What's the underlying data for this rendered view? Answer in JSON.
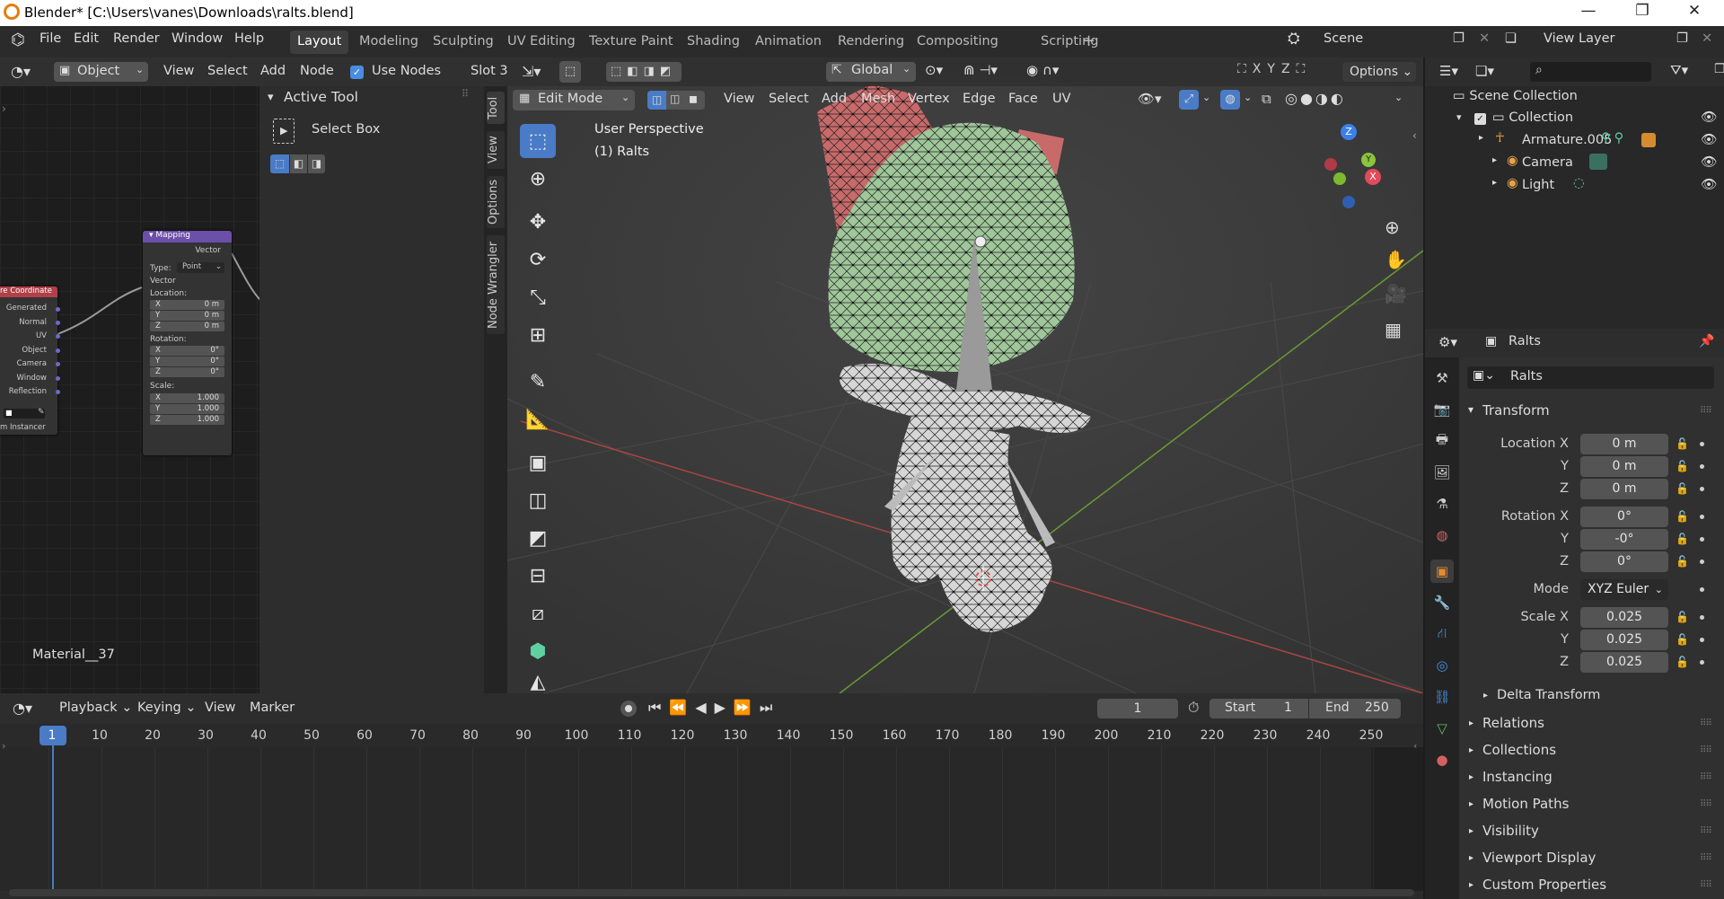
{
  "window": {
    "title": "Blender* [C:\\Users\\vanes\\Downloads\\ralts.blend]",
    "controls": [
      "—",
      "❐",
      "✕"
    ]
  },
  "menu": [
    "File",
    "Edit",
    "Render",
    "Window",
    "Help"
  ],
  "workspaces": [
    "Layout",
    "Modeling",
    "Sculpting",
    "UV Editing",
    "Texture Paint",
    "Shading",
    "Animation",
    "Rendering",
    "Compositing",
    "Scripting",
    "+"
  ],
  "active_workspace": "Layout",
  "scene": {
    "name": "Scene",
    "view_layer": "View Layer"
  },
  "node_editor": {
    "header": {
      "object_mode": "Object",
      "menus": [
        "View",
        "Select",
        "Add",
        "Node"
      ],
      "use_nodes_label": "Use Nodes",
      "use_nodes_checked": true,
      "slot": "Slot 3"
    },
    "material_name": "Material__37",
    "mapping_node": {
      "title": "Mapping",
      "output": "Vector",
      "type_label": "Type:",
      "type_value": "Point",
      "input": "Vector",
      "location_label": "Location:",
      "location": [
        {
          "axis": "X",
          "value": "0 m"
        },
        {
          "axis": "Y",
          "value": "0 m"
        },
        {
          "axis": "Z",
          "value": "0 m"
        }
      ],
      "rotation_label": "Rotation:",
      "rotation": [
        {
          "axis": "X",
          "value": "0°"
        },
        {
          "axis": "Y",
          "value": "0°"
        },
        {
          "axis": "Z",
          "value": "0°"
        }
      ],
      "scale_label": "Scale:",
      "scale": [
        {
          "axis": "X",
          "value": "1.000"
        },
        {
          "axis": "Y",
          "value": "1.000"
        },
        {
          "axis": "Z",
          "value": "1.000"
        }
      ]
    },
    "texcoord_node": {
      "title": "re Coordinate",
      "outputs": [
        "Generated",
        "Normal",
        "UV",
        "Object",
        "Camera",
        "Window",
        "Reflection"
      ],
      "footer": "m Instancer"
    }
  },
  "tool_panel": {
    "title": "Active Tool",
    "tool_name": "Select Box"
  },
  "sidebar_tabs": [
    "Tool",
    "View",
    "Options",
    "Node Wrangler"
  ],
  "viewport": {
    "mode": "Edit Mode",
    "menus": [
      "View",
      "Select",
      "Add",
      "Mesh",
      "Vertex",
      "Edge",
      "Face",
      "UV"
    ],
    "transform_orientation": "Global",
    "options_label": "Options",
    "perspective": "User Perspective",
    "object_label": "(1) Ralts",
    "axes": [
      "X",
      "Y",
      "Z"
    ],
    "colors": {
      "x_axis": "#e04a5a",
      "y_axis": "#8ac43a",
      "z_axis": "#3a80e8",
      "green_mesh": "#9fc79a",
      "red_mesh": "#c86a6a"
    }
  },
  "outliner": {
    "root": "Scene Collection",
    "collection": "Collection",
    "items": [
      {
        "name": "Armature.005",
        "icon": "armature-icon"
      },
      {
        "name": "Camera",
        "icon": "camera-icon"
      },
      {
        "name": "Light",
        "icon": "light-icon"
      }
    ]
  },
  "properties": {
    "object_name": "Ralts",
    "data_name": "Ralts",
    "transform_title": "Transform",
    "location": [
      {
        "label": "Location X",
        "value": "0 m"
      },
      {
        "label": "Y",
        "value": "0 m"
      },
      {
        "label": "Z",
        "value": "0 m"
      }
    ],
    "rotation": [
      {
        "label": "Rotation X",
        "value": "0°"
      },
      {
        "label": "Y",
        "value": "-0°"
      },
      {
        "label": "Z",
        "value": "0°"
      }
    ],
    "mode_label": "Mode",
    "mode_value": "XYZ Euler",
    "scale": [
      {
        "label": "Scale X",
        "value": "0.025"
      },
      {
        "label": "Y",
        "value": "0.025"
      },
      {
        "label": "Z",
        "value": "0.025"
      }
    ],
    "delta_transform": "Delta Transform",
    "sections": [
      "Relations",
      "Collections",
      "Instancing",
      "Motion Paths",
      "Visibility",
      "Viewport Display",
      "Custom Properties"
    ]
  },
  "timeline": {
    "menus": [
      "Playback",
      "Keying",
      "View",
      "Marker"
    ],
    "current_frame": "1",
    "start_label": "Start",
    "start": "1",
    "end_label": "End",
    "end": "250",
    "ruler": [
      "1",
      "10",
      "20",
      "30",
      "40",
      "50",
      "60",
      "70",
      "80",
      "90",
      "100",
      "110",
      "120",
      "130",
      "140",
      "150",
      "160",
      "170",
      "180",
      "190",
      "200",
      "210",
      "220",
      "230",
      "240",
      "250"
    ]
  }
}
